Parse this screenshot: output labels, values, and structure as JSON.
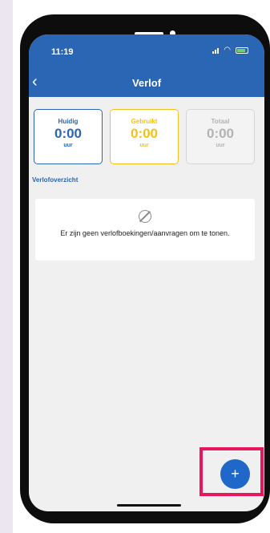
{
  "status_bar": {
    "time": "11:19"
  },
  "header": {
    "title": "Verlof"
  },
  "balance_cards": [
    {
      "label": "Huidig",
      "value": "0:00",
      "unit": "uur"
    },
    {
      "label": "Gebruikt",
      "value": "0:00",
      "unit": "uur"
    },
    {
      "label": "Totaal",
      "value": "0:00",
      "unit": "uur"
    }
  ],
  "overview": {
    "section_title": "Verlofoverzicht",
    "empty_message": "Er zijn geen verlofboekingen/aanvragen om te tonen."
  },
  "fab": {
    "label": "+"
  },
  "colors": {
    "app_bar": "#2a66b3",
    "current": "#2a66b3",
    "used": "#f2c21a",
    "total": "#b3b3b3",
    "highlight": "#e8175c"
  }
}
